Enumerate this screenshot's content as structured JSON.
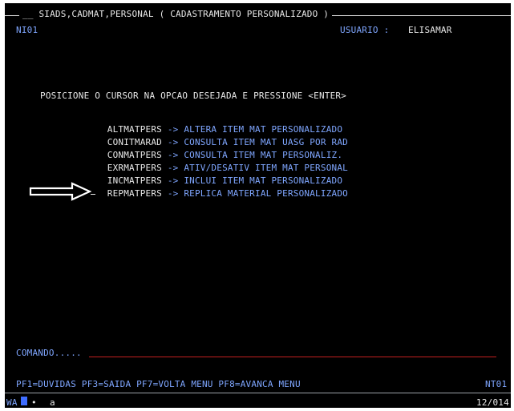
{
  "header": {
    "title": "__ SIADS,CADMAT,PERSONAL ( CADASTRAMENTO PERSONALIZADO )",
    "terminal_id": "NI01",
    "usuario_label": "USUARIO :",
    "usuario_value": "ELISAMAR"
  },
  "instruction": "POSICIONE O CURSOR NA OPCAO DESEJADA E PRESSIONE <ENTER>",
  "menu": {
    "items": [
      {
        "cmd": "ALTMATPERS",
        "arrow": "->",
        "desc": "ALTERA ITEM MAT PERSONALIZADO"
      },
      {
        "cmd": "CONITMARAD",
        "arrow": "->",
        "desc": "CONSULTA ITEM MAT UASG POR RAD"
      },
      {
        "cmd": "CONMATPERS",
        "arrow": "->",
        "desc": "CONSULTA ITEM MAT PERSONALIZ."
      },
      {
        "cmd": "EXRMATPERS",
        "arrow": "->",
        "desc": "ATIV/DESATIV ITEM MAT PERSONAL"
      },
      {
        "cmd": "INCMATPERS",
        "arrow": "->",
        "desc": "INCLUI ITEM MAT PERSONALIZADO"
      },
      {
        "cmd": "REPMATPERS",
        "arrow": "->",
        "desc": "REPLICA MATERIAL PERSONALIZADO"
      }
    ]
  },
  "comando": {
    "label": "COMANDO.....",
    "value": ""
  },
  "function_keys": "PF1=DUVIDAS PF3=SAIDA PF7=VOLTA MENU PF8=AVANCA MENU",
  "function_right": "NT01",
  "status": {
    "left": "WA",
    "mid": "a",
    "right": "12/014"
  },
  "colors": {
    "background": "#000000",
    "text": "#e8e8e8",
    "accent_blue": "#7fa6ff",
    "comando_red": "#c21f1f"
  }
}
